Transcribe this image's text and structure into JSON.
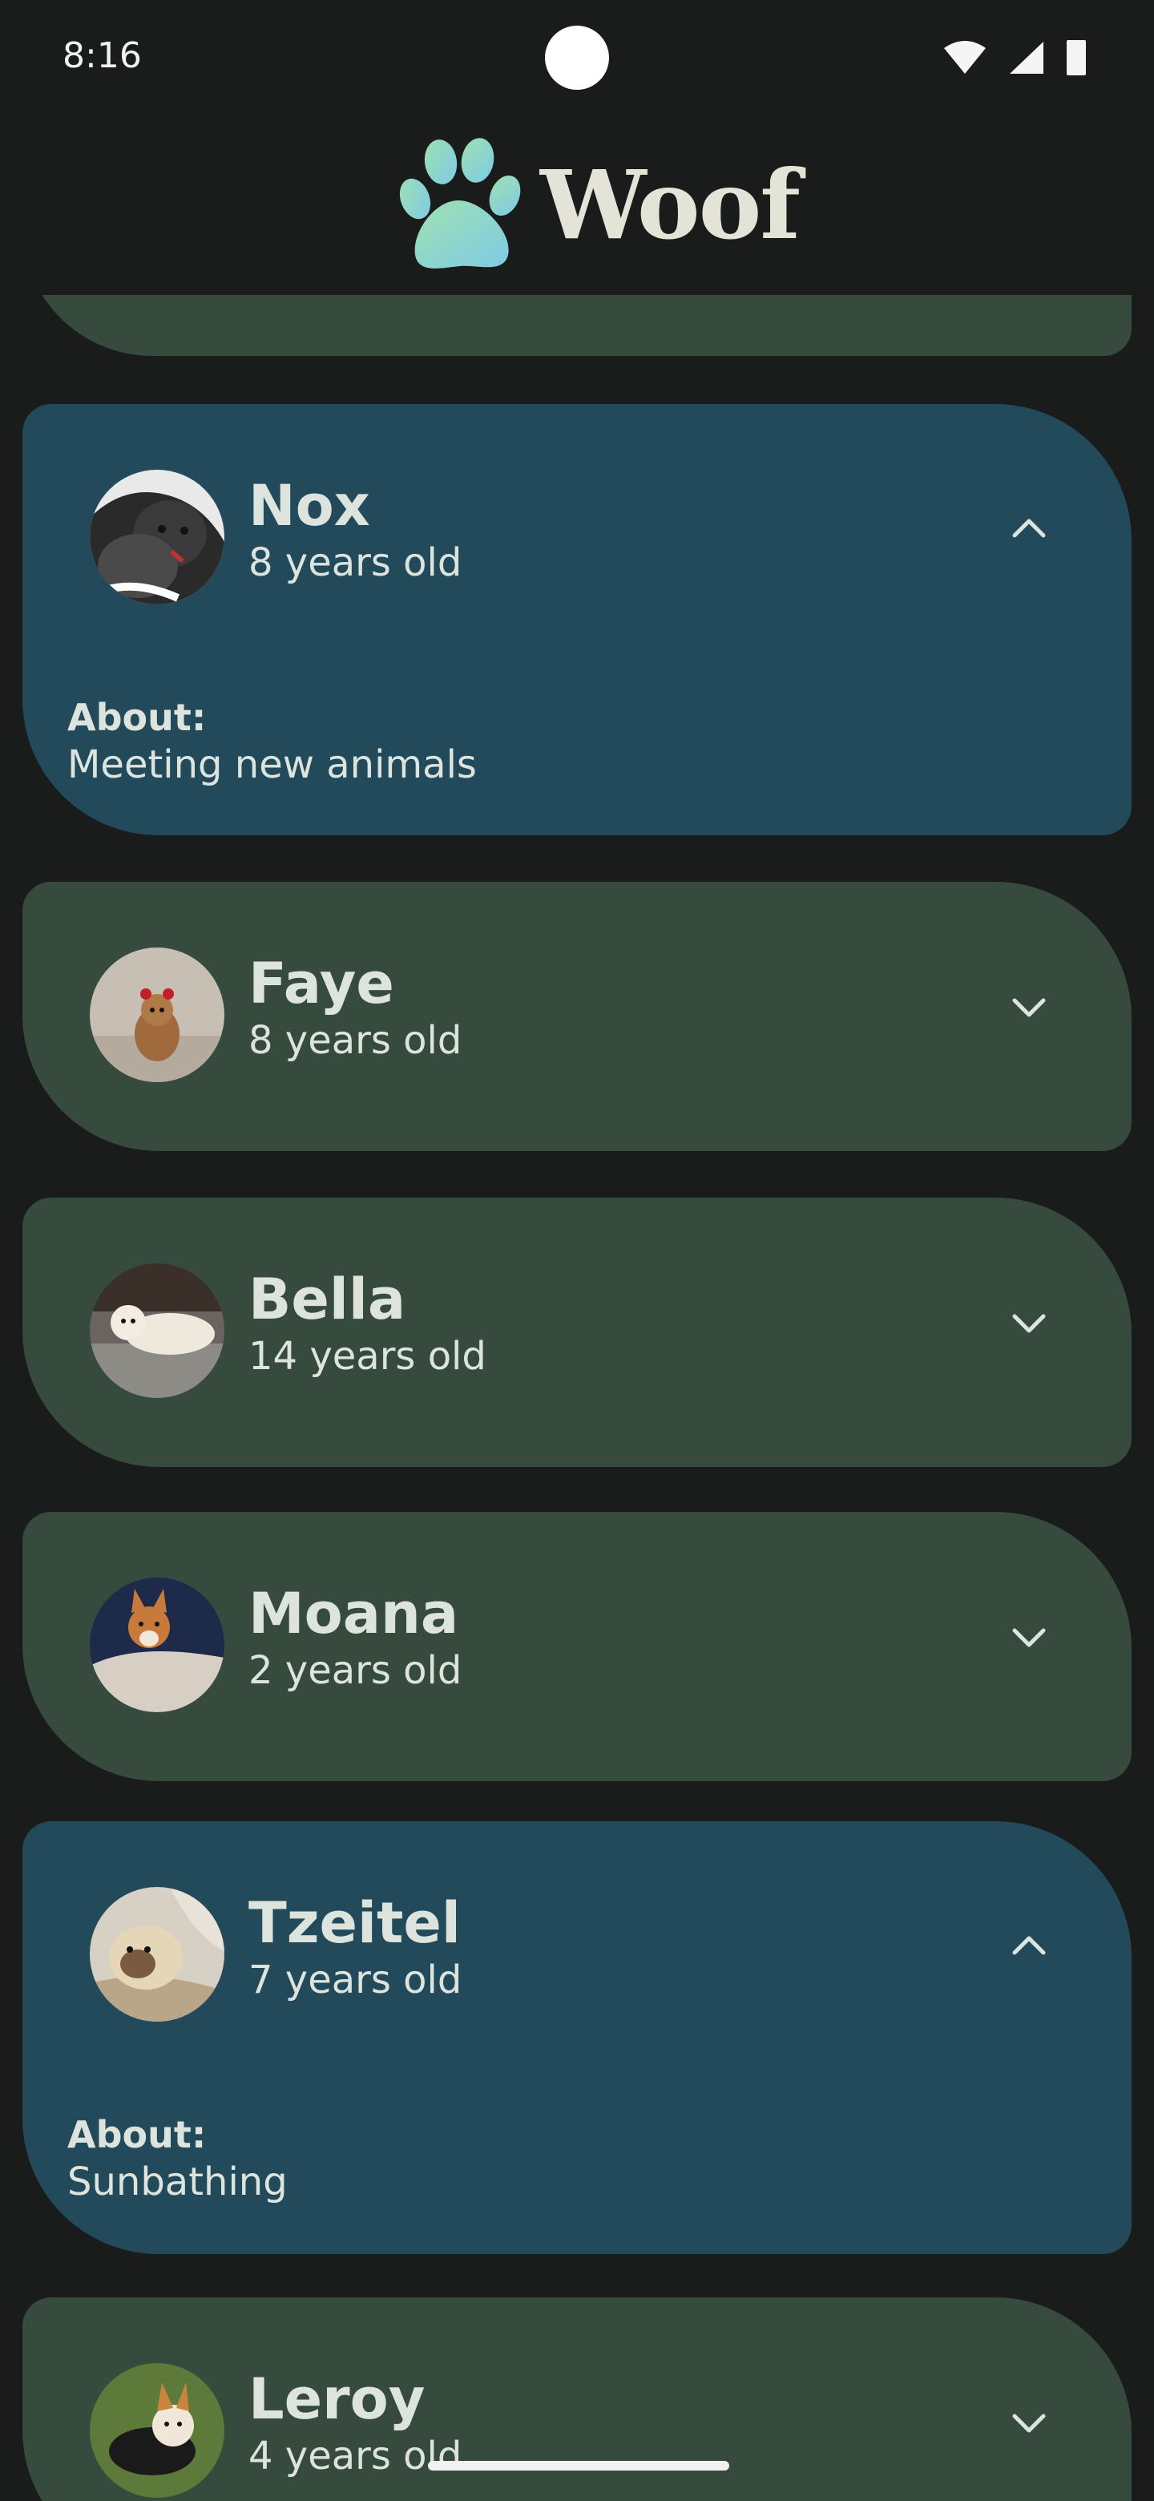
{
  "status_bar": {
    "time": "8:16",
    "icons": [
      "wifi-icon",
      "signal-icon",
      "battery-icon"
    ]
  },
  "app": {
    "title": "Woof",
    "logo_icon": "paw-icon"
  },
  "colors": {
    "background": "#191c1a",
    "card_collapsed": "#364a3d",
    "card_expanded": "#224a5b",
    "text": "#dde4dd"
  },
  "dogs": [
    {
      "name": "Nox",
      "age": "8 years old",
      "expanded": true,
      "about_label": "About:",
      "about": "Meeting new animals"
    },
    {
      "name": "Faye",
      "age": "8 years old",
      "expanded": false
    },
    {
      "name": "Bella",
      "age": "14 years old",
      "expanded": false
    },
    {
      "name": "Moana",
      "age": "2 years old",
      "expanded": false
    },
    {
      "name": "Tzeitel",
      "age": "7 years old",
      "expanded": true,
      "about_label": "About:",
      "about": "Sunbathing"
    },
    {
      "name": "Leroy",
      "age": "4 years old",
      "expanded": false
    }
  ]
}
